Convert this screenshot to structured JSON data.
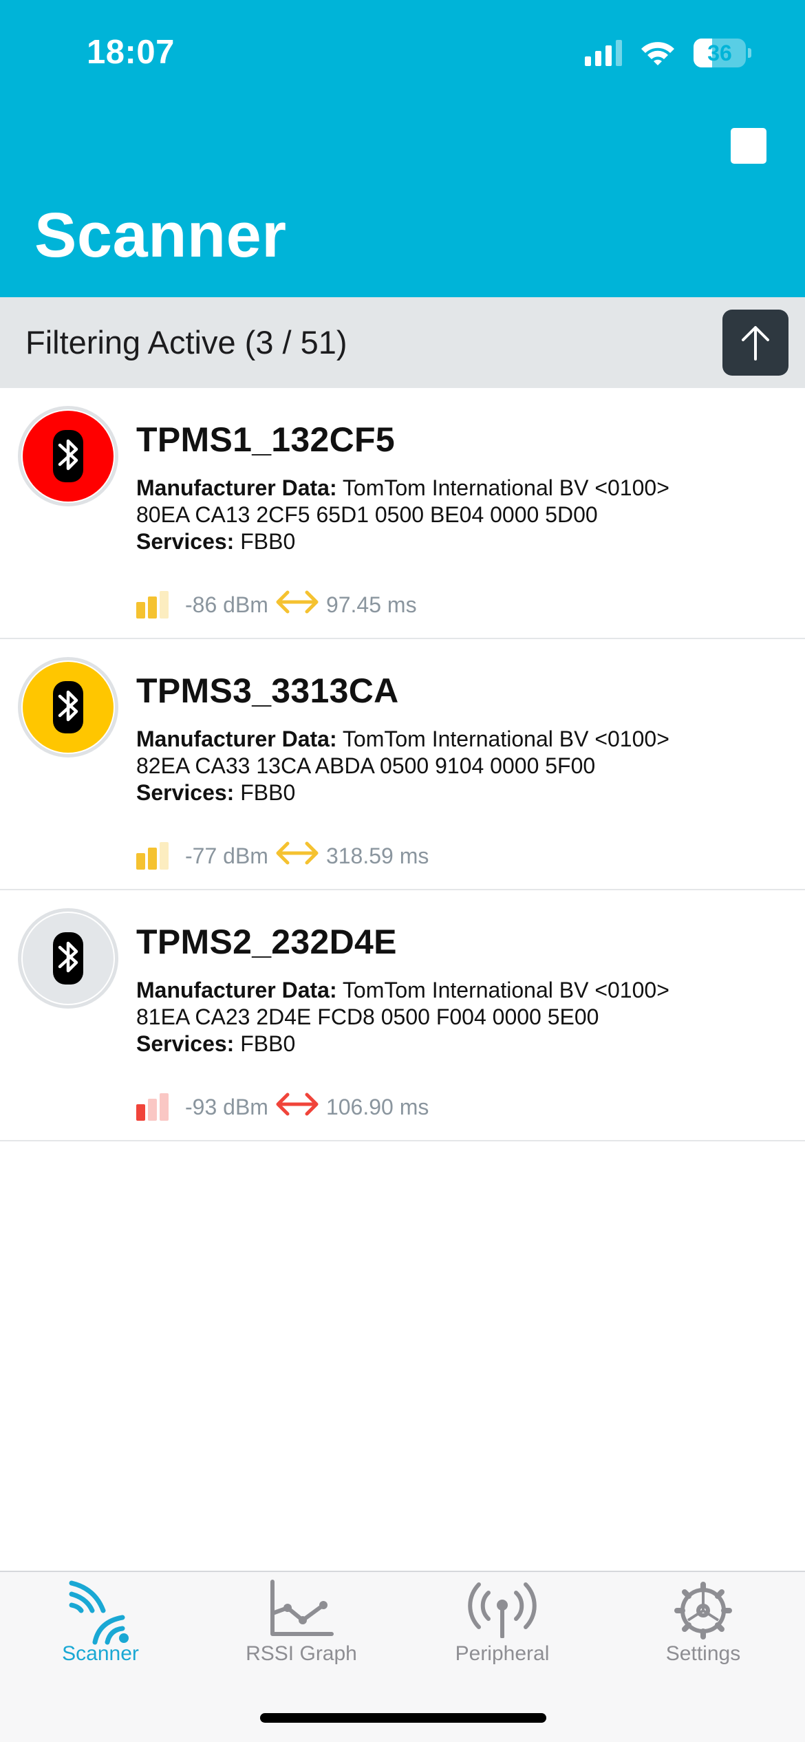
{
  "status_bar": {
    "time": "18:07",
    "battery": "36",
    "battery_level": 0.36
  },
  "header": {
    "title": "Scanner",
    "stop_icon": "stop-square-icon"
  },
  "filter": {
    "text": "Filtering Active (3 / 51)",
    "button_icon": "arrow-up-icon"
  },
  "labels": {
    "manufacturer": "Manufacturer Data:",
    "services": "Services:"
  },
  "devices": [
    {
      "name": "TPMS1_132CF5",
      "icon": "bluetooth-icon",
      "icon_color": "#ff0000",
      "manufacturer": "TomTom International BV <0100>",
      "data": "80EA CA13 2CF5 65D1 0500 BE04 0000 5D00",
      "services": "FBB0",
      "rssi": "-86 dBm",
      "interval": "97.45 ms",
      "signal_bars": 2,
      "signal_color": "#f5c230"
    },
    {
      "name": "TPMS3_3313CA",
      "icon": "bluetooth-icon",
      "icon_color": "#ffc600",
      "manufacturer": "TomTom International BV <0100>",
      "data": "82EA CA33 13CA ABDA 0500 9104 0000 5F00",
      "services": "FBB0",
      "rssi": "-77 dBm",
      "interval": "318.59 ms",
      "signal_bars": 2,
      "signal_color": "#f5c230"
    },
    {
      "name": "TPMS2_232D4E",
      "icon": "bluetooth-icon",
      "icon_color": "#e3e6e9",
      "manufacturer": "TomTom International BV <0100>",
      "data": "81EA CA23 2D4E FCD8 0500 F004 0000 5E00",
      "services": "FBB0",
      "rssi": "-93 dBm",
      "interval": "106.90 ms",
      "signal_bars": 1,
      "signal_color": "#f0443a"
    }
  ],
  "tabs": [
    {
      "label": "Scanner",
      "icon": "scanner-waves-icon",
      "active": true
    },
    {
      "label": "RSSI Graph",
      "icon": "line-graph-icon",
      "active": false
    },
    {
      "label": "Peripheral",
      "icon": "antenna-icon",
      "active": false
    },
    {
      "label": "Settings",
      "icon": "gear-icon",
      "active": false
    }
  ],
  "colors": {
    "header": "#00b4d8",
    "accent": "#1aa8d4",
    "filter_bar": "#e3e6e8"
  }
}
